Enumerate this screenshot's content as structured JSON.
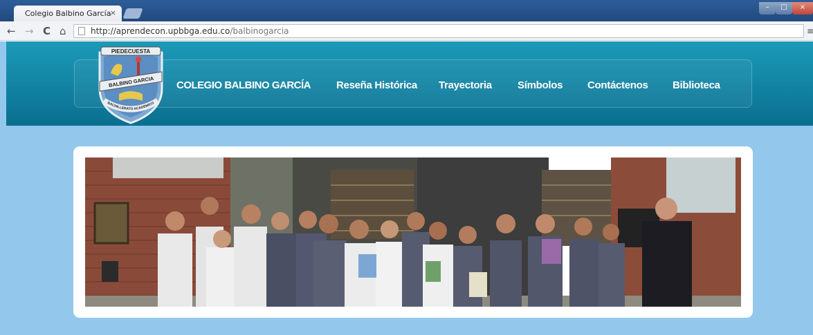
{
  "browser": {
    "tab_title": "Colegio Balbino García",
    "tab_close": "×",
    "url_host": "http://aprendecon.upbbga.edu.co",
    "url_path": "/balbinogarcia",
    "nav_icons": [
      "back-icon",
      "forward-icon",
      "reload-icon",
      "home-icon"
    ],
    "window_controls": [
      "minimize-icon",
      "maximize-icon",
      "close-icon"
    ]
  },
  "site": {
    "logo": {
      "top_text": "PIEDECUESTA",
      "band_text": "BALBINO GARCIA",
      "bottom_text": "BACHILLERATO ACADEMICO"
    },
    "brand": "COLEGIO BALBINO GARCÍA",
    "nav": [
      {
        "label": "Reseña Histórica"
      },
      {
        "label": "Trayectoria"
      },
      {
        "label": "Símbolos"
      },
      {
        "label": "Contáctenos"
      },
      {
        "label": "Biblioteca"
      }
    ],
    "colors": {
      "header": "#1388aa",
      "page_background": "#93c8ec",
      "card": "#ffffff"
    }
  },
  "banner_photo": {
    "subject": "students-in-library-photo"
  }
}
